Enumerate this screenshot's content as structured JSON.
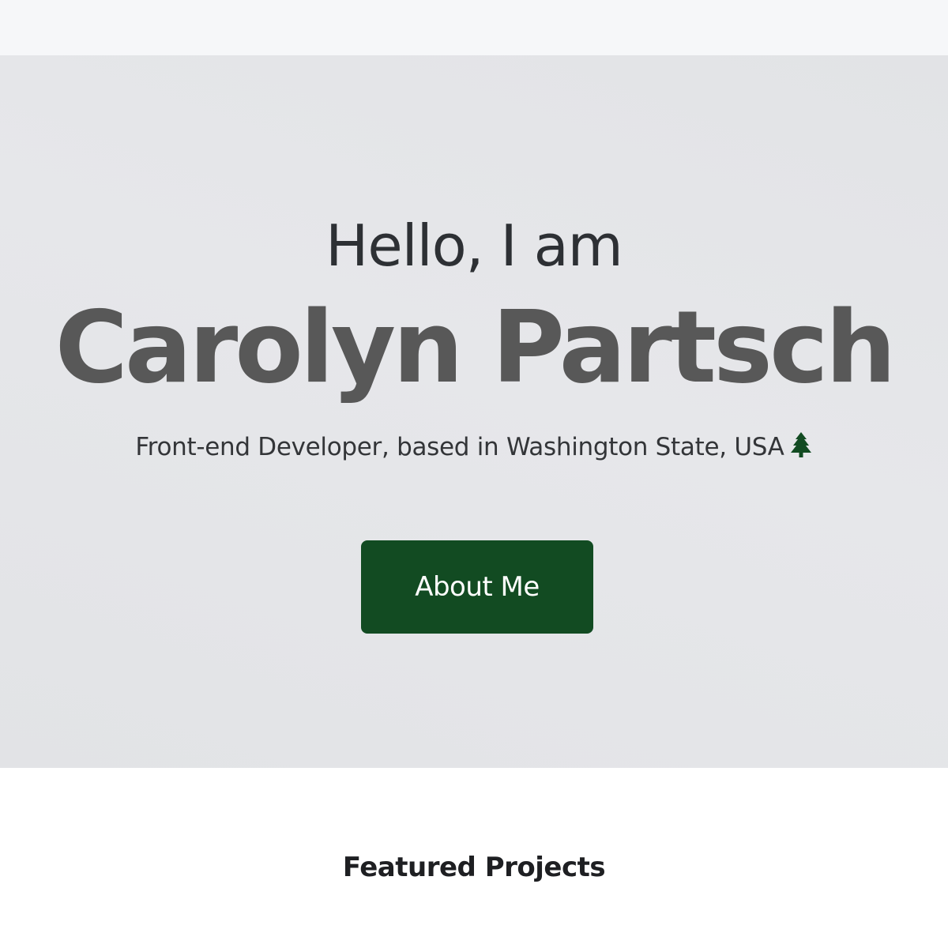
{
  "hero": {
    "greeting": "Hello, I am",
    "name": "Carolyn Partsch",
    "subtitle": "Front-end Developer, based in Washington State, USA",
    "subtitle_icon": "evergreen-tree-icon",
    "button_label": "About Me"
  },
  "featured": {
    "title": "Featured Projects"
  },
  "colors": {
    "nav_bg": "#f6f7f9",
    "hero_bg": "#e4e5e8",
    "button_bg": "#124b22",
    "name_text": "#585858",
    "tree_icon": "#124b22"
  }
}
